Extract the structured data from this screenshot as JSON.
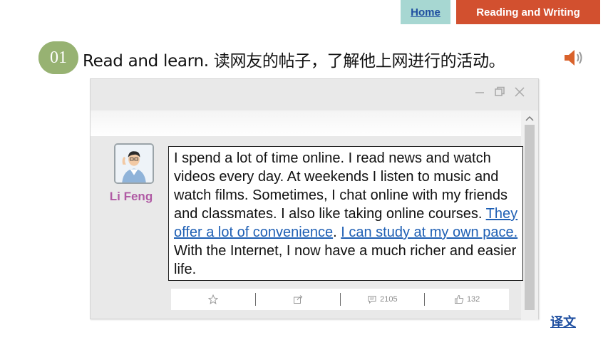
{
  "nav": {
    "home_label": "Home",
    "section_label": "Reading and Writing"
  },
  "instruction": {
    "number": "01",
    "text": "Read and learn. 读网友的帖子，了解他上网进行的活动。"
  },
  "post": {
    "user_name": "Li Feng",
    "text_part1": "I spend a lot of time online. I read news and watch videos every day. At weekends I listen to music and watch films. Sometimes, I chat online with my friends and classmates. I also like taking online courses. ",
    "link1": "They offer a lot of convenience",
    "text_part2": ". ",
    "link2": "I can study at my own pace. ",
    "text_part3": "With the Internet, I now have a much richer and easier life."
  },
  "actions": {
    "comments_count": "2105",
    "likes_count": "132"
  },
  "translate_label": "译文",
  "colors": {
    "home_bg": "#a7d7d2",
    "section_bg": "#d2502f",
    "badge_bg": "#97b272",
    "name_color": "#b05aa4",
    "link_color": "#1e5fb4"
  },
  "icons": [
    "speaker-icon",
    "minimize-icon",
    "restore-icon",
    "close-icon",
    "scroll-up-icon",
    "star-icon",
    "share-icon",
    "comment-icon",
    "thumbs-up-icon"
  ]
}
